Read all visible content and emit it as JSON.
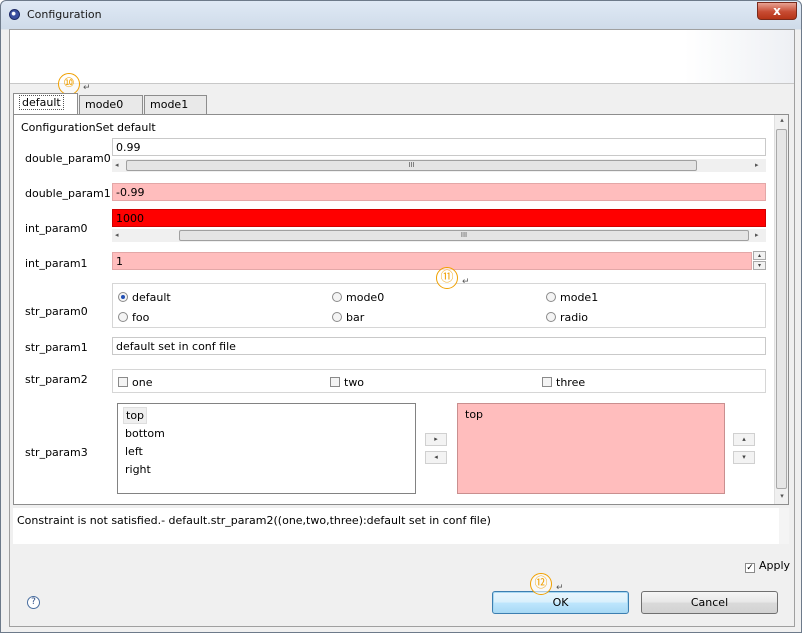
{
  "window": {
    "title": "Configuration",
    "close_glyph": "x"
  },
  "callouts": [
    "⑩",
    "⑪",
    "⑫"
  ],
  "return_mark": "↵",
  "tabs": [
    {
      "label": "default",
      "active": true
    },
    {
      "label": "mode0",
      "active": false
    },
    {
      "label": "mode1",
      "active": false
    }
  ],
  "config_set": {
    "label": "ConfigurationSet :",
    "value": "default"
  },
  "params": {
    "double_param0": {
      "label": "double_param0",
      "value": "0.99"
    },
    "double_param1": {
      "label": "double_param1",
      "value": "-0.99"
    },
    "int_param0": {
      "label": "int_param0",
      "value": "1000"
    },
    "int_param1": {
      "label": "int_param1",
      "value": "1"
    },
    "str_param0": {
      "label": "str_param0",
      "options": [
        "default",
        "mode0",
        "mode1",
        "foo",
        "bar",
        "radio"
      ],
      "selected": "default"
    },
    "str_param1": {
      "label": "str_param1",
      "value": "default set in conf file"
    },
    "str_param2": {
      "label": "str_param2",
      "options": [
        "one",
        "two",
        "three"
      ],
      "checked": []
    },
    "str_param3": {
      "label": "str_param3",
      "available": [
        "top",
        "bottom",
        "left",
        "right"
      ],
      "selected_items": [
        "top"
      ]
    }
  },
  "scroll_glyphs": {
    "left": "◂",
    "right": "▸",
    "up": "▴",
    "down": "▾",
    "grip": "III",
    "move_right": "▸",
    "move_left": "◂"
  },
  "message": "Constraint is not satisfied.- default.str_param2((one,two,three):default set in conf file)",
  "apply": {
    "label": "Apply",
    "checked": true,
    "check_glyph": "✓"
  },
  "help_glyph": "?",
  "buttons": {
    "ok": "OK",
    "cancel": "Cancel"
  },
  "colors": {
    "invalid_light": "#ffbdbd",
    "invalid_strong": "#ff0000",
    "callout": "#f0a000"
  }
}
